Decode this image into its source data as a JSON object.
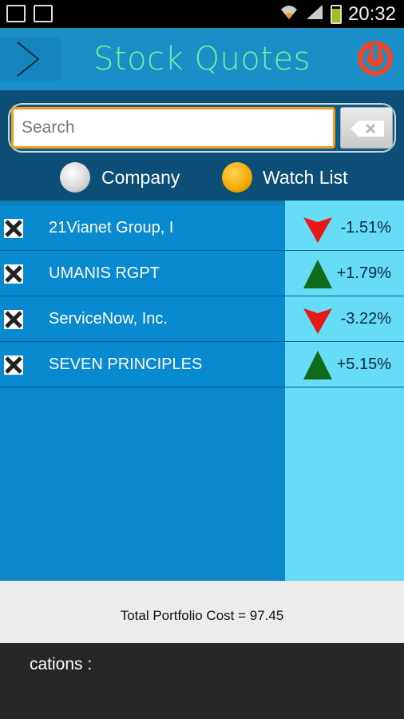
{
  "status_bar": {
    "time": "20:32",
    "icons": [
      "sd-card-icon",
      "image-icon",
      "wifi-icon",
      "signal-icon",
      "battery-charging-icon"
    ]
  },
  "header": {
    "title": "Stock Quotes",
    "title_color": "#6df2a0",
    "menu_icon": "chevron-right-icon",
    "power_icon": "power-icon",
    "power_color": "#e8482c"
  },
  "search": {
    "placeholder": "Search",
    "value": "",
    "clear_icon": "backspace-icon"
  },
  "filter": {
    "options": [
      {
        "label": "Company",
        "selected": false
      },
      {
        "label": "Watch List",
        "selected": true
      }
    ]
  },
  "stocks": [
    {
      "name": "21Vianet Group, I",
      "change": "-1.51%",
      "trend": "down"
    },
    {
      "name": "UMANIS RGPT",
      "change": "+1.79%",
      "trend": "up"
    },
    {
      "name": "ServiceNow, Inc.",
      "change": "-3.22%",
      "trend": "down"
    },
    {
      "name": "SEVEN PRINCIPLES",
      "change": "+5.15%",
      "trend": "up"
    }
  ],
  "colors": {
    "up": "#0f6b1a",
    "down": "#e81717",
    "accent": "#f39b1c"
  },
  "total": {
    "text": "Total Portfolio Cost = 97.45"
  },
  "bottom": {
    "text": "cations :"
  }
}
